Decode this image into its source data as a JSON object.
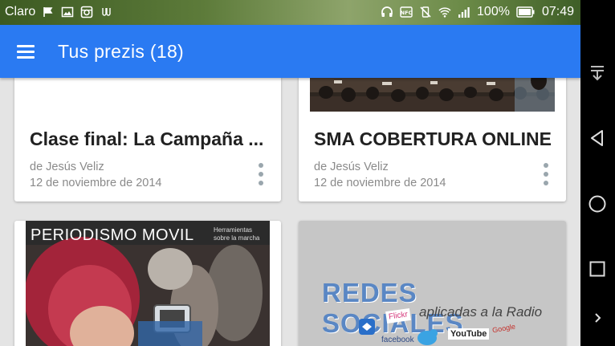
{
  "status_bar": {
    "carrier": "Claro",
    "battery": "100%",
    "time": "07:49",
    "icons_left": [
      "flag-icon",
      "image-icon",
      "instagram-icon",
      "voicemail-icon"
    ],
    "icons_right": [
      "headphones-icon",
      "nfc-icon",
      "vibrate-off-icon",
      "wifi-icon",
      "signal-icon",
      "battery-icon"
    ]
  },
  "app_bar": {
    "title": "Tus prezis (18)",
    "color": "#2a7af2"
  },
  "cards": [
    {
      "title": "Clase final: La Campaña ...",
      "author": "de Jesús Veliz",
      "date": "12 de noviembre de 2014"
    },
    {
      "title": "SMA COBERTURA ONLINE",
      "author": "de Jesús Veliz",
      "date": "12 de noviembre de 2014"
    },
    {
      "thumb_title": "PERIODISMO MOVIL",
      "thumb_subtitle_1": "Herramientas",
      "thumb_subtitle_2": "sobre la marcha"
    },
    {
      "thumb_title": "REDES SOCIALES",
      "thumb_subtitle": "aplicadas a la Radio",
      "thumb_logos": [
        "Flickr",
        "YouTube",
        "Google",
        "facebook"
      ]
    }
  ],
  "nav_bar": {
    "icons": [
      "download-icon",
      "back-icon",
      "home-icon",
      "recents-icon",
      "chevron-right-icon"
    ]
  }
}
